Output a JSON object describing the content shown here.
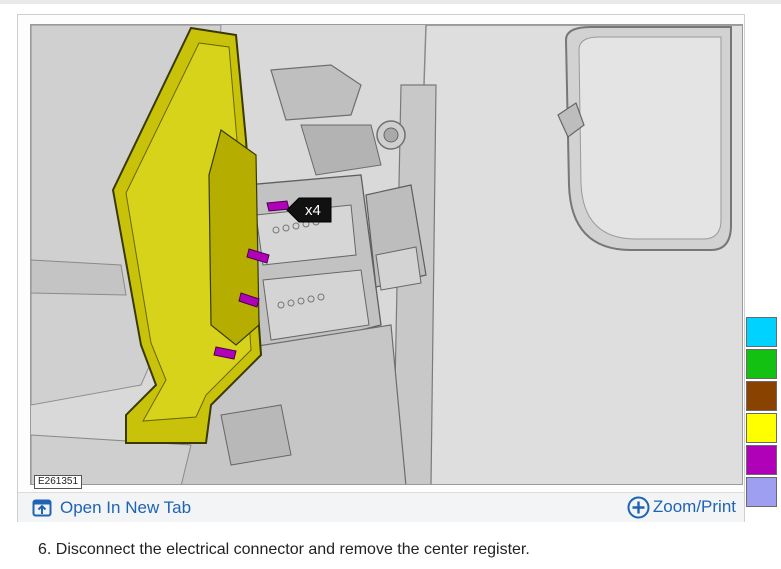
{
  "figure": {
    "id_label": "E261351",
    "callout": "x4"
  },
  "toolbar": {
    "open_label": "Open In New Tab",
    "zoom_label": "Zoom/Print"
  },
  "colors": {
    "swatches": [
      "#00d2ff",
      "#13c113",
      "#8a4200",
      "#ffff00",
      "#b000b8",
      "#9f9ff2"
    ],
    "link": "#1f63b4",
    "highlight_part": "#c8c20a",
    "clip_highlight": "#b000b8"
  },
  "step": {
    "text": "6. Disconnect the electrical connector and remove the center register."
  }
}
